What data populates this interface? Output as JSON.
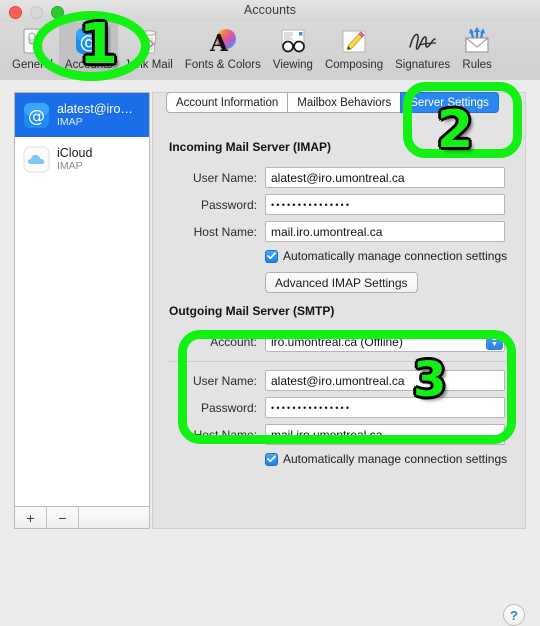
{
  "window": {
    "title": "Accounts",
    "traffic_lights": [
      "close",
      "minimize",
      "zoom"
    ]
  },
  "toolbar": {
    "items": [
      {
        "label": "General",
        "icon": "general-switch-icon",
        "selected": false
      },
      {
        "label": "Accounts",
        "icon": "at-sign-account-icon",
        "selected": true
      },
      {
        "label": "Junk Mail",
        "icon": "trash-junk-icon",
        "selected": false
      },
      {
        "label": "Fonts & Colors",
        "icon": "font-colors-icon",
        "selected": false
      },
      {
        "label": "Viewing",
        "icon": "glasses-viewing-icon",
        "selected": false
      },
      {
        "label": "Composing",
        "icon": "pencil-composing-icon",
        "selected": false
      },
      {
        "label": "Signatures",
        "icon": "signature-icon",
        "selected": false
      },
      {
        "label": "Rules",
        "icon": "envelope-rules-icon",
        "selected": false
      }
    ]
  },
  "sidebar": {
    "accounts": [
      {
        "name": "alatest@iro…",
        "type": "IMAP",
        "icon": "at-sign-account-icon",
        "selected": true
      },
      {
        "name": "iCloud",
        "type": "IMAP",
        "icon": "icloud-cloud-icon",
        "selected": false
      }
    ],
    "footer": {
      "add_label": "+",
      "remove_label": "−"
    }
  },
  "tabs": [
    {
      "label": "Account Information",
      "selected": false
    },
    {
      "label": "Mailbox Behaviors",
      "selected": false
    },
    {
      "label": "Server Settings",
      "selected": true
    }
  ],
  "incoming": {
    "heading": "Incoming Mail Server (IMAP)",
    "user_name_label": "User Name:",
    "user_name_value": "alatest@iro.umontreal.ca",
    "password_label": "Password:",
    "password_value": "•••••••••••••••",
    "host_name_label": "Host Name:",
    "host_name_value": "mail.iro.umontreal.ca",
    "auto_manage_label": "Automatically manage connection settings",
    "auto_manage_checked": true,
    "advanced_button": "Advanced IMAP Settings"
  },
  "outgoing": {
    "heading": "Outgoing Mail Server (SMTP)",
    "account_label": "Account:",
    "account_value": "iro.umontreal.ca (Offline)",
    "user_name_label": "User Name:",
    "user_name_value": "alatest@iro.umontreal.ca",
    "password_label": "Password:",
    "password_value": "•••••••••••••••",
    "host_name_label": "Host Name:",
    "host_name_value": "mail.iro.umontreal.ca",
    "auto_manage_label": "Automatically manage connection settings",
    "auto_manage_checked": true
  },
  "help": {
    "label": "?"
  },
  "annotations": {
    "color": "#13f013",
    "steps": [
      {
        "number": "1",
        "shape": "ellipse",
        "target": "toolbar-accounts"
      },
      {
        "number": "2",
        "shape": "rounded-rect",
        "target": "tab-server-settings"
      },
      {
        "number": "3",
        "shape": "rounded-rect",
        "target": "outgoing-credentials"
      }
    ]
  }
}
